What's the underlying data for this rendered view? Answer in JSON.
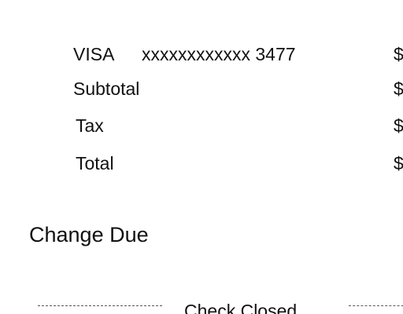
{
  "receipt": {
    "cutoff_heading": "- - - - - -",
    "payment": {
      "card_label": "VISA",
      "card_number": "xxxxxxxxxxxx 3477",
      "amount": "$"
    },
    "subtotal": {
      "label": "Subtotal",
      "amount": "$"
    },
    "tax": {
      "label": "Tax",
      "amount": "$"
    },
    "total": {
      "label": "Total",
      "amount": "$"
    },
    "change_due_label": "Change Due",
    "footer_label": "Check Closed"
  }
}
